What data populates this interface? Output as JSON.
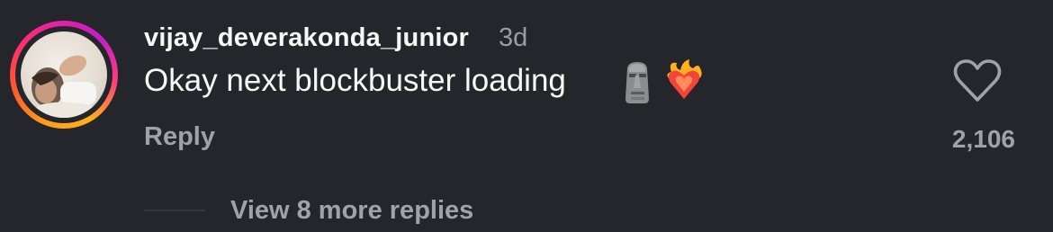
{
  "comment": {
    "username": "vijay_deverakonda_junior",
    "timestamp": "3d",
    "text": "Okay next blockbuster loading",
    "emojis": [
      "moai-emoji",
      "heart-on-fire-emoji"
    ],
    "reply_label": "Reply",
    "like_count": "2,106"
  },
  "replies": {
    "view_more_label": "View 8 more replies"
  },
  "colors": {
    "background": "#25262b",
    "primary_text": "#f7f7f7",
    "secondary_text": "#a0a2a8"
  }
}
